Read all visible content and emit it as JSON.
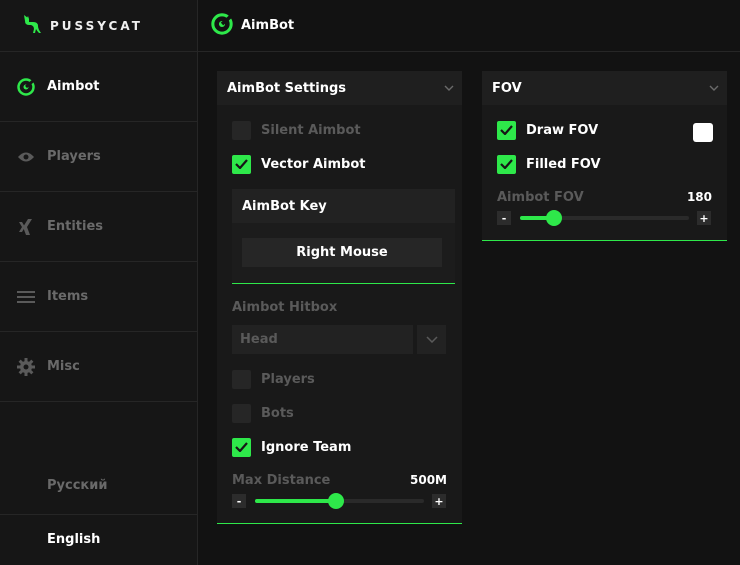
{
  "brand": {
    "name": "PUSSYCAT"
  },
  "colors": {
    "accent": "#2ee84a",
    "fov_color": "#ffffff"
  },
  "sidebar": {
    "items": [
      {
        "label": "Aimbot",
        "icon": "radar-icon",
        "active": true
      },
      {
        "label": "Players",
        "icon": "eye-icon",
        "active": false
      },
      {
        "label": "Entities",
        "icon": "xing-icon",
        "active": false
      },
      {
        "label": "Items",
        "icon": "menu-icon",
        "active": false
      },
      {
        "label": "Misc",
        "icon": "gear-icon",
        "active": false
      }
    ],
    "languages": [
      {
        "label": "Русский",
        "active": false
      },
      {
        "label": "English",
        "active": true
      }
    ]
  },
  "topbar": {
    "title": "AimBot",
    "icon": "radar-icon"
  },
  "aimbot_settings": {
    "title": "AimBot Settings",
    "silent_aimbot": {
      "label": "Silent Aimbot",
      "checked": false
    },
    "vector_aimbot": {
      "label": "Vector Aimbot",
      "checked": true
    },
    "key": {
      "title": "AimBot Key",
      "value": "Right Mouse"
    },
    "hitbox": {
      "label": "Aimbot Hitbox",
      "value": "Head"
    },
    "players": {
      "label": "Players",
      "checked": false
    },
    "bots": {
      "label": "Bots",
      "checked": false
    },
    "ignore_team": {
      "label": "Ignore Team",
      "checked": true
    },
    "max_distance": {
      "label": "Max Distance",
      "value": "500M",
      "fraction": 0.48,
      "minus": "-",
      "plus": "+"
    }
  },
  "fov": {
    "title": "FOV",
    "draw_fov": {
      "label": "Draw FOV",
      "checked": true
    },
    "filled_fov": {
      "label": "Filled FOV",
      "checked": true
    },
    "aimbot_fov": {
      "label": "Aimbot FOV",
      "value": "180",
      "fraction": 0.2,
      "minus": "-",
      "plus": "+"
    }
  }
}
